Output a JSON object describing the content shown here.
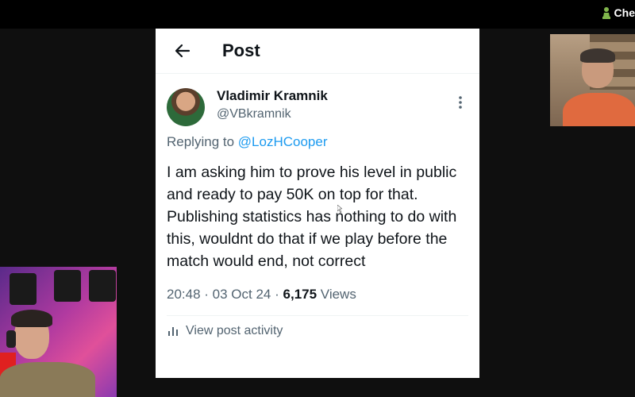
{
  "brand": {
    "text": "Che",
    "icon": "chess-pawn-icon",
    "color": "#81b64c"
  },
  "post": {
    "header_title": "Post",
    "author": {
      "name": "Vladimir Kramnik",
      "handle": "@VBkramnik"
    },
    "reply_prefix": "Replying to ",
    "reply_to": "@LozHCooper",
    "text_paragraphs": [
      "I am asking him to prove his level in public and ready to pay 50K on top for that.",
      "Publishing statistics has nothing to do with this, wouldnt do that if we play before the match would end, not correct"
    ],
    "time": "20:48",
    "date": "03 Oct 24",
    "views_count": "6,175",
    "views_label": "Views",
    "activity_label": "View post activity",
    "link_color": "#1d9bf0"
  }
}
